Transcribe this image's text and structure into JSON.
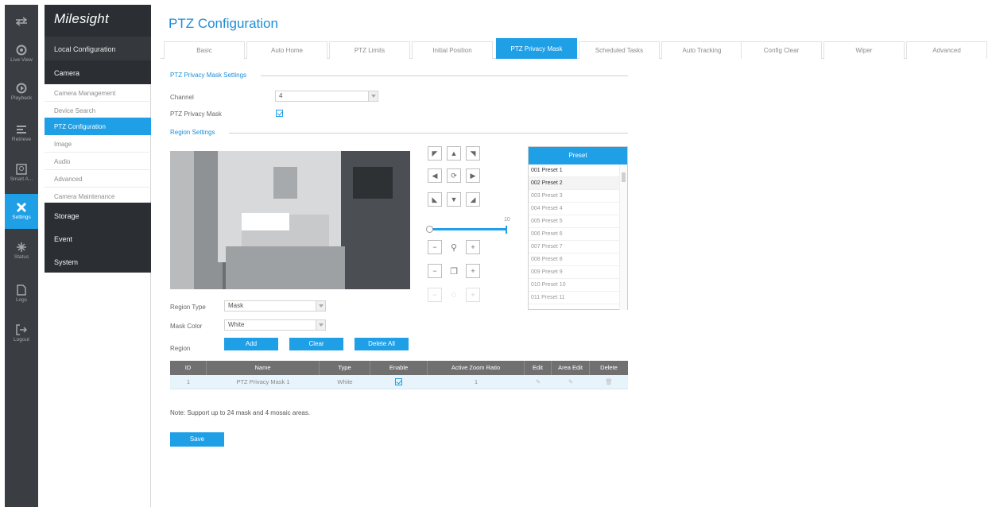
{
  "rail": {
    "items": [
      {
        "icon": "swap-arrows-icon",
        "label": ""
      },
      {
        "icon": "live-view-icon",
        "label": "Live View"
      },
      {
        "icon": "playback-icon",
        "label": "Playback"
      },
      {
        "icon": "retrieve-icon",
        "label": "Retrieve"
      },
      {
        "icon": "smart-analysis-icon",
        "label": "Smart A..."
      },
      {
        "icon": "settings-icon",
        "label": "Settings"
      },
      {
        "icon": "status-icon",
        "label": "Status"
      },
      {
        "icon": "logs-icon",
        "label": "Logs"
      },
      {
        "icon": "logout-icon",
        "label": "Logout"
      }
    ]
  },
  "brand": "Milesight",
  "menu": {
    "local_config": "Local Configuration",
    "camera": "Camera",
    "camera_items": [
      "Camera Management",
      "Device Search",
      "PTZ Configuration",
      "Image",
      "Audio",
      "Advanced",
      "Camera Maintenance"
    ],
    "storage": "Storage",
    "event": "Event",
    "system": "System"
  },
  "page": {
    "title": "PTZ Configuration",
    "tabs": [
      "Basic",
      "Auto Home",
      "PTZ Limits",
      "Initial Position",
      "PTZ Privacy Mask",
      "Scheduled Tasks",
      "Auto Tracking",
      "Config Clear",
      "Wiper",
      "Advanced"
    ]
  },
  "settings": {
    "section_title": "PTZ Privacy Mask Settings",
    "channel_label": "Channel",
    "channel_value": "4",
    "mask_label": "PTZ Privacy Mask",
    "region_settings_title": "Region Settings"
  },
  "ptz": {
    "speed_value": "10"
  },
  "preset": {
    "header": "Preset",
    "items": [
      "001  Preset 1",
      "002  Preset 2",
      "003  Preset 3",
      "004  Preset 4",
      "005  Preset 5",
      "006  Preset 6",
      "007  Preset 7",
      "008  Preset 8",
      "009  Preset 9",
      "010  Preset 10",
      "011  Preset 11"
    ]
  },
  "region": {
    "type_label": "Region Type",
    "type_value": "Mask",
    "color_label": "Mask Color",
    "color_value": "White",
    "region_label": "Region",
    "add_label": "Add",
    "clear_label": "Clear",
    "delete_all_label": "Delete All"
  },
  "table": {
    "headers": [
      "ID",
      "Name",
      "Type",
      "Enable",
      "Active Zoom Ratio",
      "Edit",
      "Area Edit",
      "Delete"
    ],
    "rows": [
      {
        "id": "1",
        "name": "PTZ Privacy Mask 1",
        "type": "White",
        "zoom": "1"
      }
    ]
  },
  "note": "Note: Support up to 24 mask and 4 mosaic areas.",
  "save_label": "Save",
  "colors": {
    "accent": "#1e9fe6",
    "dark": "#2b2f33",
    "rail": "#3a3d42"
  }
}
